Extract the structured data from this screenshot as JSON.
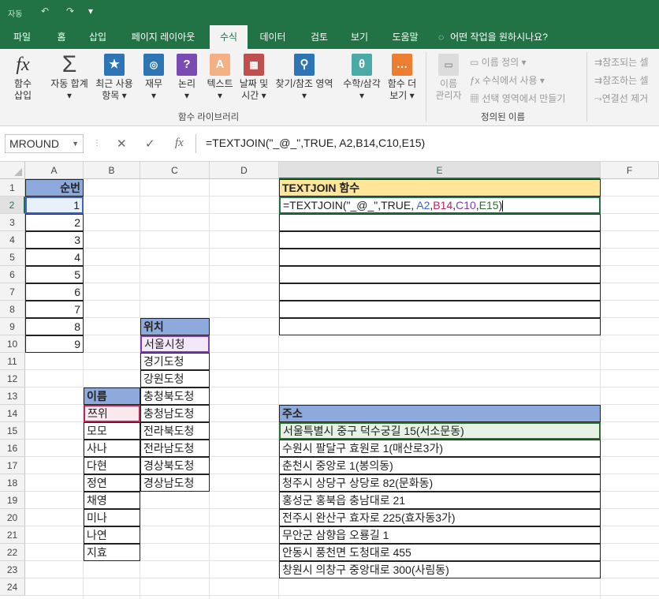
{
  "quick_access": {
    "autosave": "자동",
    "undo": "↶",
    "redo": "↷",
    "more": "▾"
  },
  "tabs": [
    "파일",
    "홈",
    "삽입",
    "페이지 레이아웃",
    "수식",
    "데이터",
    "검토",
    "보기",
    "도움말"
  ],
  "active_tab": "수식",
  "tell_me": "어떤 작업을 원하시나요?",
  "ribbon": {
    "insert_function": {
      "line1": "함수",
      "line2": "삽입"
    },
    "autosum": {
      "line1": "자동 합계",
      "line2": "▾"
    },
    "recent": {
      "line1": "최근 사용",
      "line2": "항목 ▾"
    },
    "financial": {
      "line1": "재무",
      "line2": "▾"
    },
    "logical": {
      "line1": "논리",
      "line2": "▾"
    },
    "text": {
      "line1": "텍스트",
      "line2": "▾"
    },
    "datetime": {
      "line1": "날짜 및",
      "line2": "시간 ▾"
    },
    "lookup": {
      "line1": "찾기/참조 영역",
      "line2": "▾"
    },
    "math": {
      "line1": "수학/삼각",
      "line2": "▾"
    },
    "more": {
      "line1": "함수 더",
      "line2": "보기 ▾"
    },
    "library_label": "함수 라이브러리",
    "name_manager": {
      "line1": "이름",
      "line2": "관리자"
    },
    "define_name": "이름 정의 ▾",
    "use_in_formula": "수식에서 사용 ▾",
    "create_from_selection": "선택 영역에서 만들기",
    "defined_names_label": "정의된 이름",
    "trace_precedents": "참조되는 셀",
    "trace_dependents": "참조하는 셀",
    "remove_arrows": "연결선 제거"
  },
  "namebox": "MROUND",
  "formula_bar": "=TEXTJOIN(\"_@_\",TRUE, A2,B14,C10,E15)",
  "columns": [
    "A",
    "B",
    "C",
    "D",
    "E",
    "F"
  ],
  "rows": [
    "1",
    "2",
    "3",
    "4",
    "5",
    "6",
    "7",
    "8",
    "9",
    "10",
    "11",
    "12",
    "13",
    "14",
    "15",
    "16",
    "17",
    "18",
    "19",
    "20",
    "21",
    "22",
    "23",
    "24"
  ],
  "colA": {
    "header": "순번",
    "values": [
      "1",
      "2",
      "3",
      "4",
      "5",
      "6",
      "7",
      "8",
      "9"
    ]
  },
  "colB": {
    "header": "이름",
    "values": [
      "쯔위",
      "모모",
      "사나",
      "다현",
      "정연",
      "채영",
      "미나",
      "나연",
      "지효"
    ]
  },
  "colC": {
    "header": "위치",
    "values": [
      "서울시청",
      "경기도청",
      "강원도청",
      "충청북도청",
      "충청남도청",
      "전라북도청",
      "전라남도청",
      "경상북도청",
      "경상남도청"
    ]
  },
  "colE": {
    "title": "TEXTJOIN 함수",
    "formula_prefix": "=TEXTJOIN(\"_@_\",TRUE, ",
    "ref_a": "A2",
    "comma1": ",",
    "ref_b": "B14",
    "comma2": ",",
    "ref_c": "C10",
    "comma3": ",",
    "ref_e": "E15",
    "formula_suffix": ")",
    "addr_header": "주소",
    "addresses": [
      "서울특별시 중구 덕수궁길 15(서소문동)",
      "수원시 팔달구 효원로 1(매산로3가)",
      "춘천시 중앙로 1(봉의동)",
      "청주시 상당구 상당로 82(문화동)",
      "홍성군 홍북읍 충남대로 21",
      "전주시 완산구 효자로 225(효자동3가)",
      "무안군 삼향읍 오룡길 1",
      "안동시 풍천면 도청대로 455",
      "창원시 의창구 중앙대로 300(사림동)"
    ]
  },
  "colors": {
    "excel_green": "#217346",
    "header_blue": "#8ea9db",
    "title_yellow": "#ffe699"
  }
}
